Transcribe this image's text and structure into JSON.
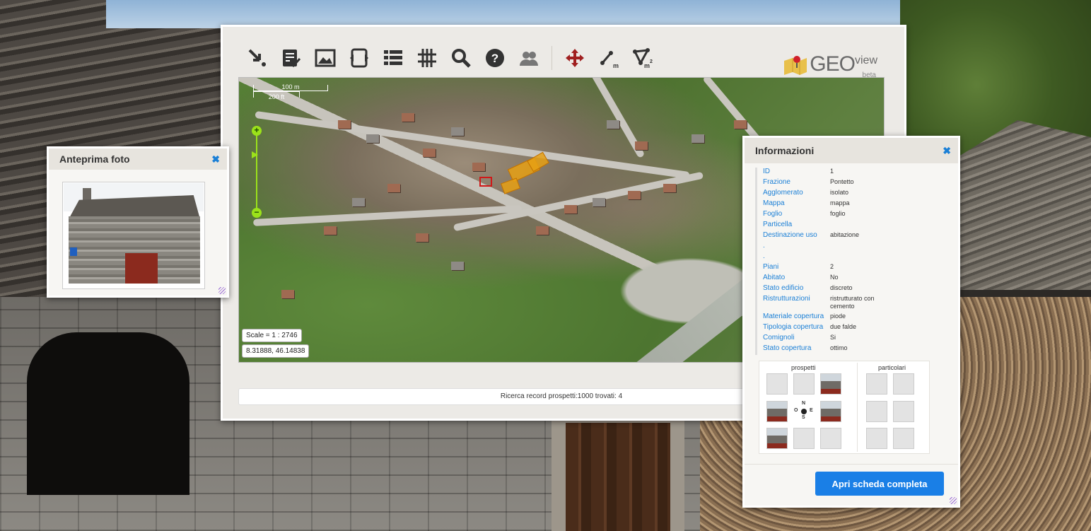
{
  "toolbar": {
    "tools": [
      {
        "name": "select-arrow-icon"
      },
      {
        "name": "checklist-icon"
      },
      {
        "name": "image-icon"
      },
      {
        "name": "expand-icon"
      },
      {
        "name": "layers-list-icon"
      },
      {
        "name": "grid-icon"
      },
      {
        "name": "search-icon"
      },
      {
        "name": "help-icon"
      },
      {
        "name": "users-icon"
      },
      {
        "name": "pan-icon",
        "color": "#a02020"
      },
      {
        "name": "measure-length-icon",
        "unit": "m"
      },
      {
        "name": "measure-area-icon",
        "unit": "m²"
      }
    ]
  },
  "logo": {
    "geo": "GEO",
    "view": "view",
    "beta": "beta"
  },
  "map": {
    "scale_top": "100 m",
    "scale_bottom": "200 ft",
    "zoom_in": "+",
    "zoom_out": "−",
    "scale_text": "Scale = 1 : 2746",
    "coords_text": "8.31888, 46.14838"
  },
  "status": {
    "text": "Ricerca record prospetti:1000 trovati: 4"
  },
  "photo_panel": {
    "title": "Anteprima foto"
  },
  "info_panel": {
    "title": "Informazioni",
    "rows": [
      {
        "k": "ID",
        "v": "1"
      },
      {
        "k": "Frazione",
        "v": "Pontetto"
      },
      {
        "k": "Agglomerato",
        "v": "isolato"
      },
      {
        "k": "Mappa",
        "v": "mappa"
      },
      {
        "k": "Foglio",
        "v": "foglio"
      },
      {
        "k": "Particella",
        "v": ""
      },
      {
        "k": "Destinazione uso",
        "v": "abitazione"
      },
      {
        "k": ".",
        "v": ""
      },
      {
        "k": ".",
        "v": ""
      },
      {
        "k": "Piani",
        "v": "2"
      },
      {
        "k": "Abitato",
        "v": "No"
      },
      {
        "k": "Stato edificio",
        "v": "discreto"
      },
      {
        "k": "Ristrutturazioni",
        "v": "ristrutturato con cemento"
      },
      {
        "k": "Materiale copertura",
        "v": "piode"
      },
      {
        "k": "Tipologia copertura",
        "v": "due falde"
      },
      {
        "k": "Comignoli",
        "v": "Si"
      },
      {
        "k": "Stato copertura",
        "v": "ottimo"
      }
    ],
    "prospetti_label": "prospetti",
    "particolari_label": "particolari",
    "compass": {
      "n": "N",
      "s": "S",
      "o": "O",
      "e": "E"
    },
    "button": "Apri scheda completa"
  },
  "colors": {
    "accent": "#1a7fe6",
    "link": "#1a7fd6",
    "zoom": "#9be21a",
    "highlight": "#e6a014"
  }
}
